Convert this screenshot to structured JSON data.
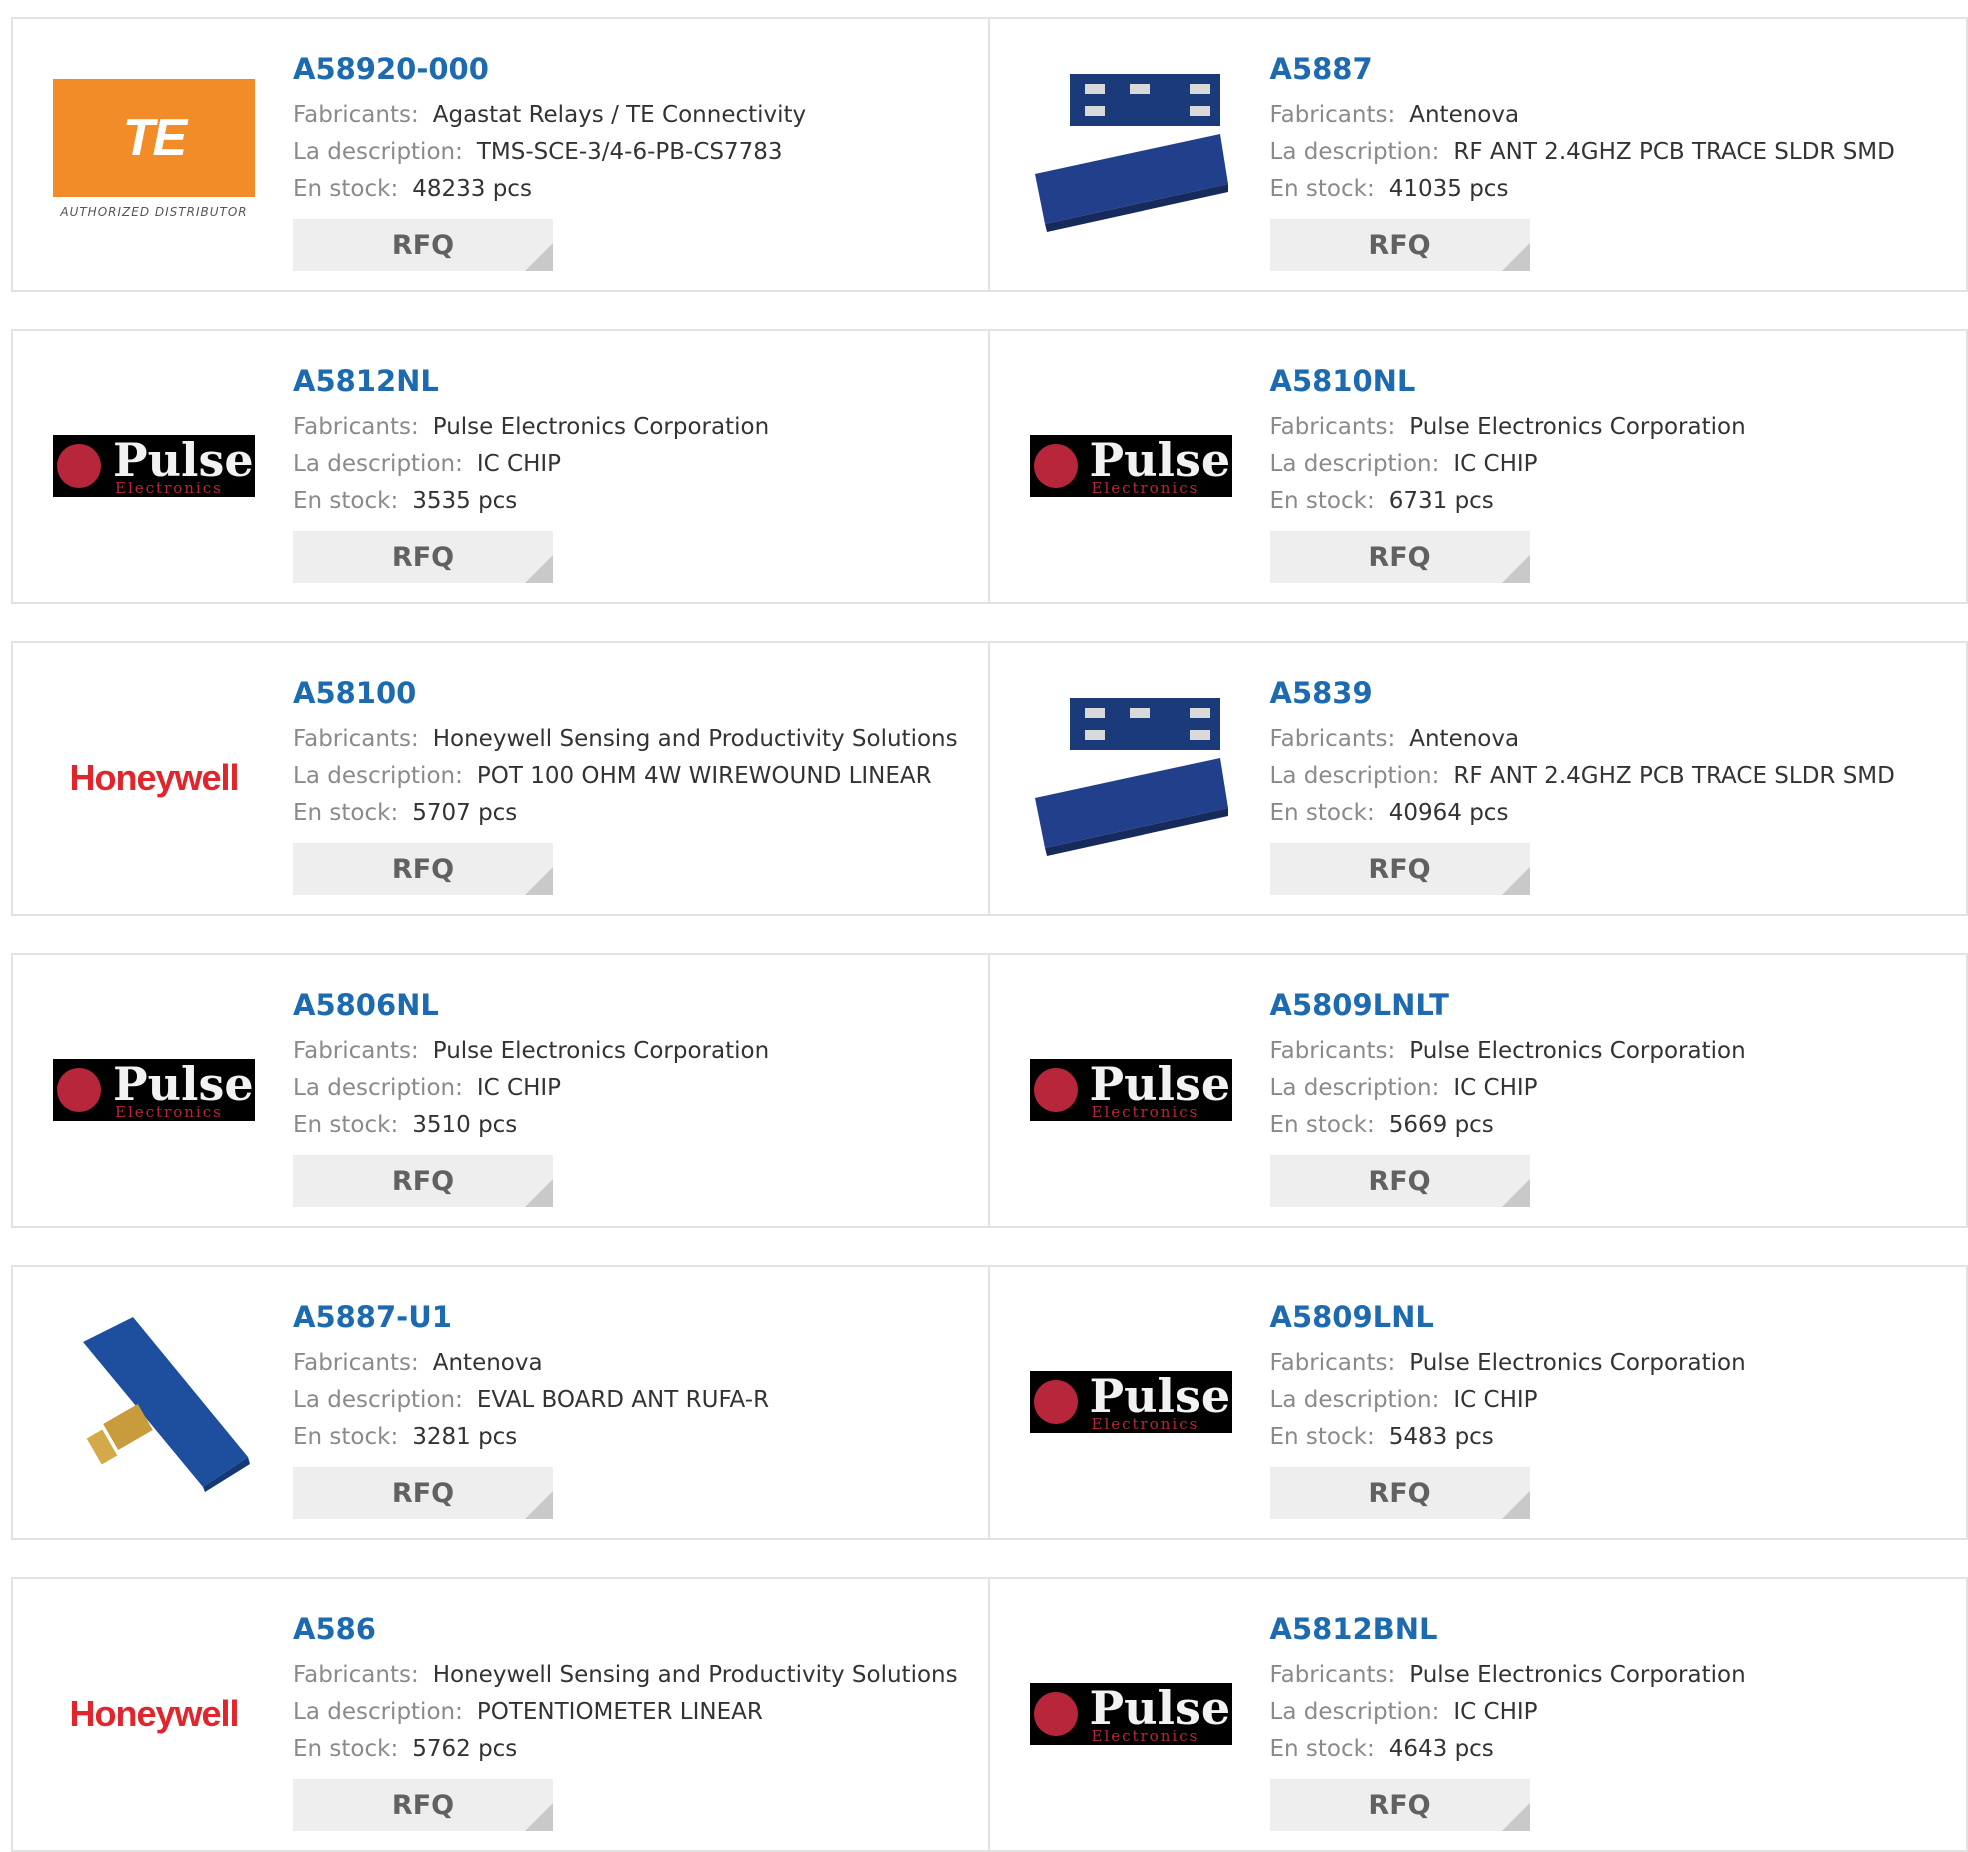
{
  "colors": {
    "part_number": "#1d6aaf",
    "label": "#8a8a8a",
    "value": "#333333",
    "rfq_bg": "#eeeeee"
  },
  "labels": {
    "manufacturer": "Fabricants:",
    "description": "La description:",
    "stock": "En stock:",
    "rfq": "RFQ"
  },
  "logo_text": {
    "te": "TE",
    "te_sub": "AUTHORIZED DISTRIBUTOR",
    "pulse": "Pulse",
    "pulse_sub": "Electronics",
    "honeywell": "Honeywell"
  },
  "products": [
    {
      "part": "A58920-000",
      "manufacturer": "Agastat Relays / TE Connectivity",
      "description": "TMS-SCE-3/4-6-PB-CS7783",
      "stock": "48233 pcs",
      "logo": "te-logo"
    },
    {
      "part": "A5887",
      "manufacturer": "Antenova",
      "description": "RF ANT 2.4GHZ PCB TRACE SLDR SMD",
      "stock": "41035 pcs",
      "logo": "antenna-chip-image"
    },
    {
      "part": "A5812NL",
      "manufacturer": "Pulse Electronics Corporation",
      "description": "IC CHIP",
      "stock": "3535 pcs",
      "logo": "pulse-logo"
    },
    {
      "part": "A5810NL",
      "manufacturer": "Pulse Electronics Corporation",
      "description": "IC CHIP",
      "stock": "6731 pcs",
      "logo": "pulse-logo"
    },
    {
      "part": "A58100",
      "manufacturer": "Honeywell Sensing and Productivity Solutions",
      "description": "POT 100 OHM 4W WIREWOUND LINEAR",
      "stock": "5707 pcs",
      "logo": "honeywell-logo"
    },
    {
      "part": "A5839",
      "manufacturer": "Antenova",
      "description": "RF ANT 2.4GHZ PCB TRACE SLDR SMD",
      "stock": "40964 pcs",
      "logo": "antenna-chip-image"
    },
    {
      "part": "A5806NL",
      "manufacturer": "Pulse Electronics Corporation",
      "description": "IC CHIP",
      "stock": "3510 pcs",
      "logo": "pulse-logo"
    },
    {
      "part": "A5809LNLT",
      "manufacturer": "Pulse Electronics Corporation",
      "description": "IC CHIP",
      "stock": "5669 pcs",
      "logo": "pulse-logo"
    },
    {
      "part": "A5887-U1",
      "manufacturer": "Antenova",
      "description": "EVAL BOARD ANT RUFA-R",
      "stock": "3281 pcs",
      "logo": "eval-board-image"
    },
    {
      "part": "A5809LNL",
      "manufacturer": "Pulse Electronics Corporation",
      "description": "IC CHIP",
      "stock": "5483 pcs",
      "logo": "pulse-logo"
    },
    {
      "part": "A586",
      "manufacturer": "Honeywell Sensing and Productivity Solutions",
      "description": "POTENTIOMETER LINEAR",
      "stock": "5762 pcs",
      "logo": "honeywell-logo"
    },
    {
      "part": "A5812BNL",
      "manufacturer": "Pulse Electronics Corporation",
      "description": "IC CHIP",
      "stock": "4643 pcs",
      "logo": "pulse-logo"
    }
  ]
}
